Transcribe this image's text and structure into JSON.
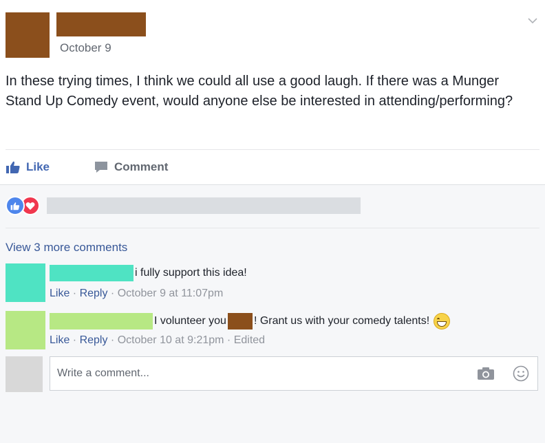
{
  "post": {
    "date": "October 9",
    "text": "In these trying times, I think we could all use a good laugh. If there was a Munger Stand Up Comedy event, would anyone else be interested in attending/performing?",
    "actions": {
      "like_label": "Like",
      "comment_label": "Comment"
    }
  },
  "reactions": {
    "icons": [
      "like-icon",
      "love-icon"
    ]
  },
  "comments": {
    "view_more": "View 3 more comments",
    "items": [
      {
        "text": "i fully support this idea!",
        "like": "Like",
        "reply": "Reply",
        "sep": " · ",
        "timestamp": "October 9 at 11:07pm"
      },
      {
        "text_before": "I volunteer you",
        "text_after": "! Grant us with your comedy talents!",
        "like": "Like",
        "reply": "Reply",
        "sep": " · ",
        "timestamp": "October 10 at 9:21pm",
        "edited": "Edited"
      }
    ]
  },
  "composer": {
    "placeholder": "Write a comment..."
  },
  "colors": {
    "redaction_brown": "#8b4f1c",
    "avatar_teal": "#4fe3c3",
    "avatar_green": "#b7e884",
    "link_blue": "#385898",
    "like_blue": "#4267b2"
  }
}
